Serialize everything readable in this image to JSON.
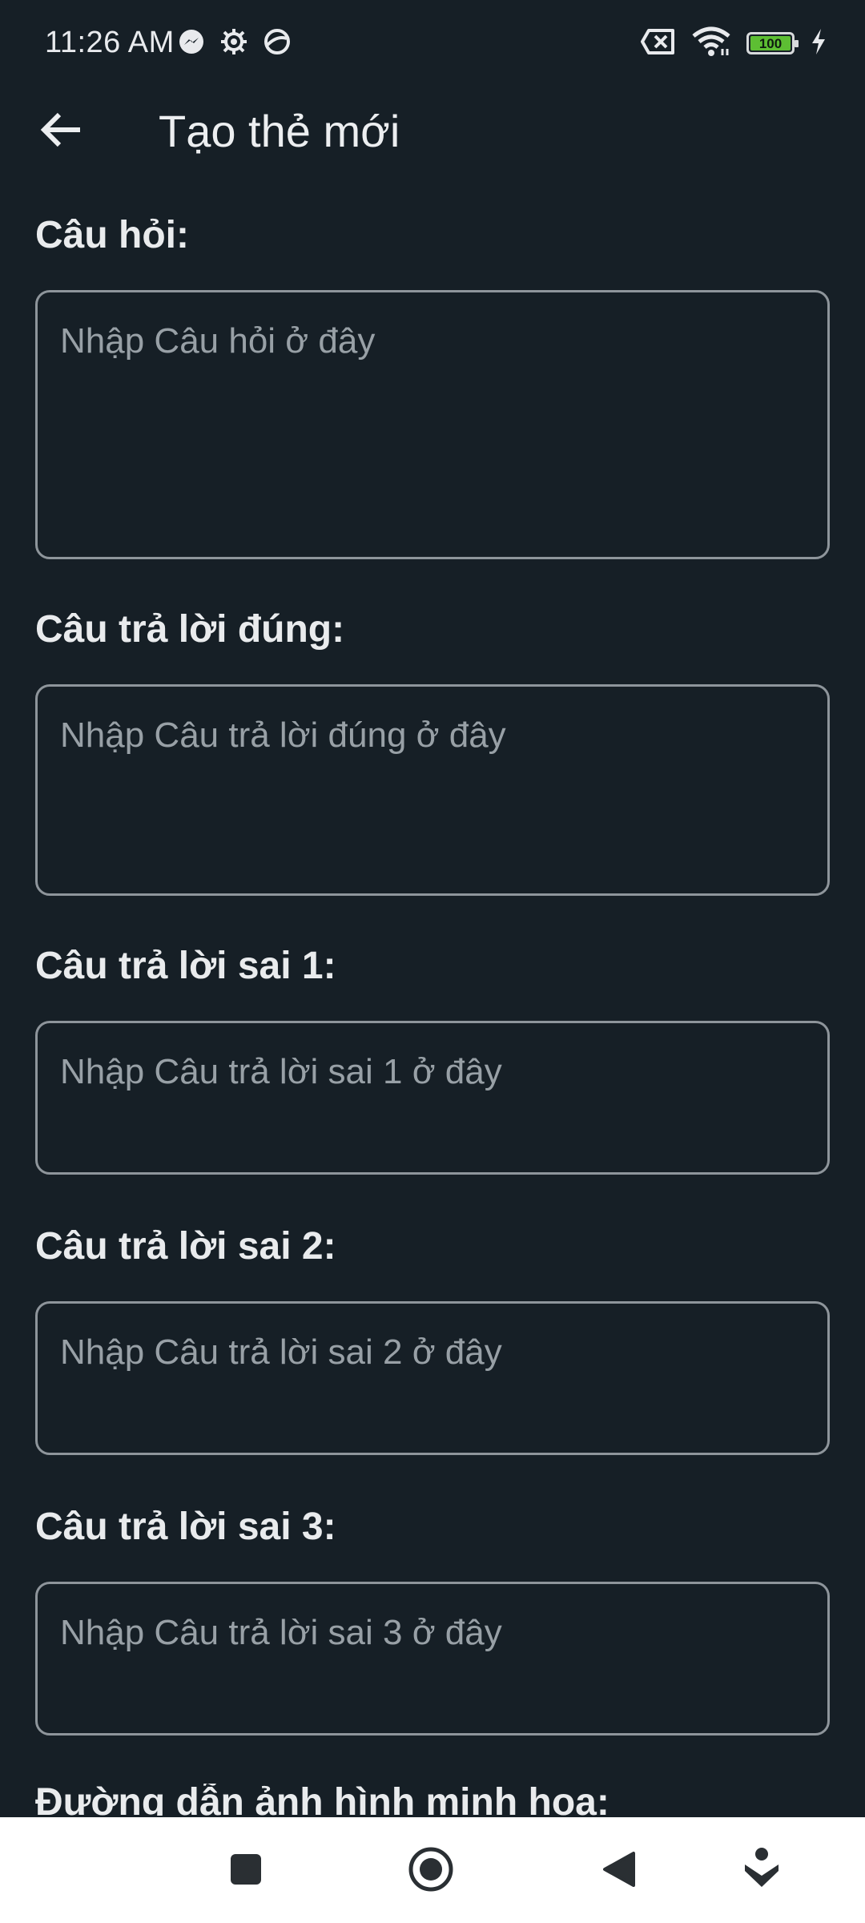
{
  "status_bar": {
    "time": "11:26 AM",
    "battery_level": "100",
    "icons": [
      "messenger-icon",
      "settings-gear-icon",
      "vpn-globe-icon",
      "sim-off-icon",
      "wifi-icon",
      "battery-icon",
      "charging-bolt-icon"
    ],
    "battery_color": "#5dbe33"
  },
  "app_bar": {
    "title": "Tạo thẻ mới",
    "back_icon": "arrow-left-icon"
  },
  "form": {
    "question": {
      "label": "Câu hỏi:",
      "placeholder": "Nhập Câu hỏi ở đây",
      "value": ""
    },
    "correct_answer": {
      "label": "Câu trả lời đúng:",
      "placeholder": "Nhập Câu trả lời đúng ở đây",
      "value": ""
    },
    "wrong_answer_1": {
      "label": "Câu trả lời sai 1:",
      "placeholder": "Nhập Câu trả lời sai 1 ở đây",
      "value": ""
    },
    "wrong_answer_2": {
      "label": "Câu trả lời sai 2:",
      "placeholder": "Nhập Câu trả lời sai 2 ở đây",
      "value": ""
    },
    "wrong_answer_3": {
      "label": "Câu trả lời sai 3:",
      "placeholder": "Nhập Câu trả lời sai 3 ở đây",
      "value": ""
    },
    "image_path_label": "Đường dẫn ảnh hình minh họa:"
  },
  "nav_bar": {
    "buttons": [
      "recents-square-icon",
      "home-circle-icon",
      "back-triangle-icon",
      "assistant-icon"
    ]
  },
  "colors": {
    "background": "#161f26",
    "text": "#e9ebed",
    "placeholder": "#98a0a6",
    "field_border": "#8e959b",
    "nav_bar": "#ffffff"
  }
}
